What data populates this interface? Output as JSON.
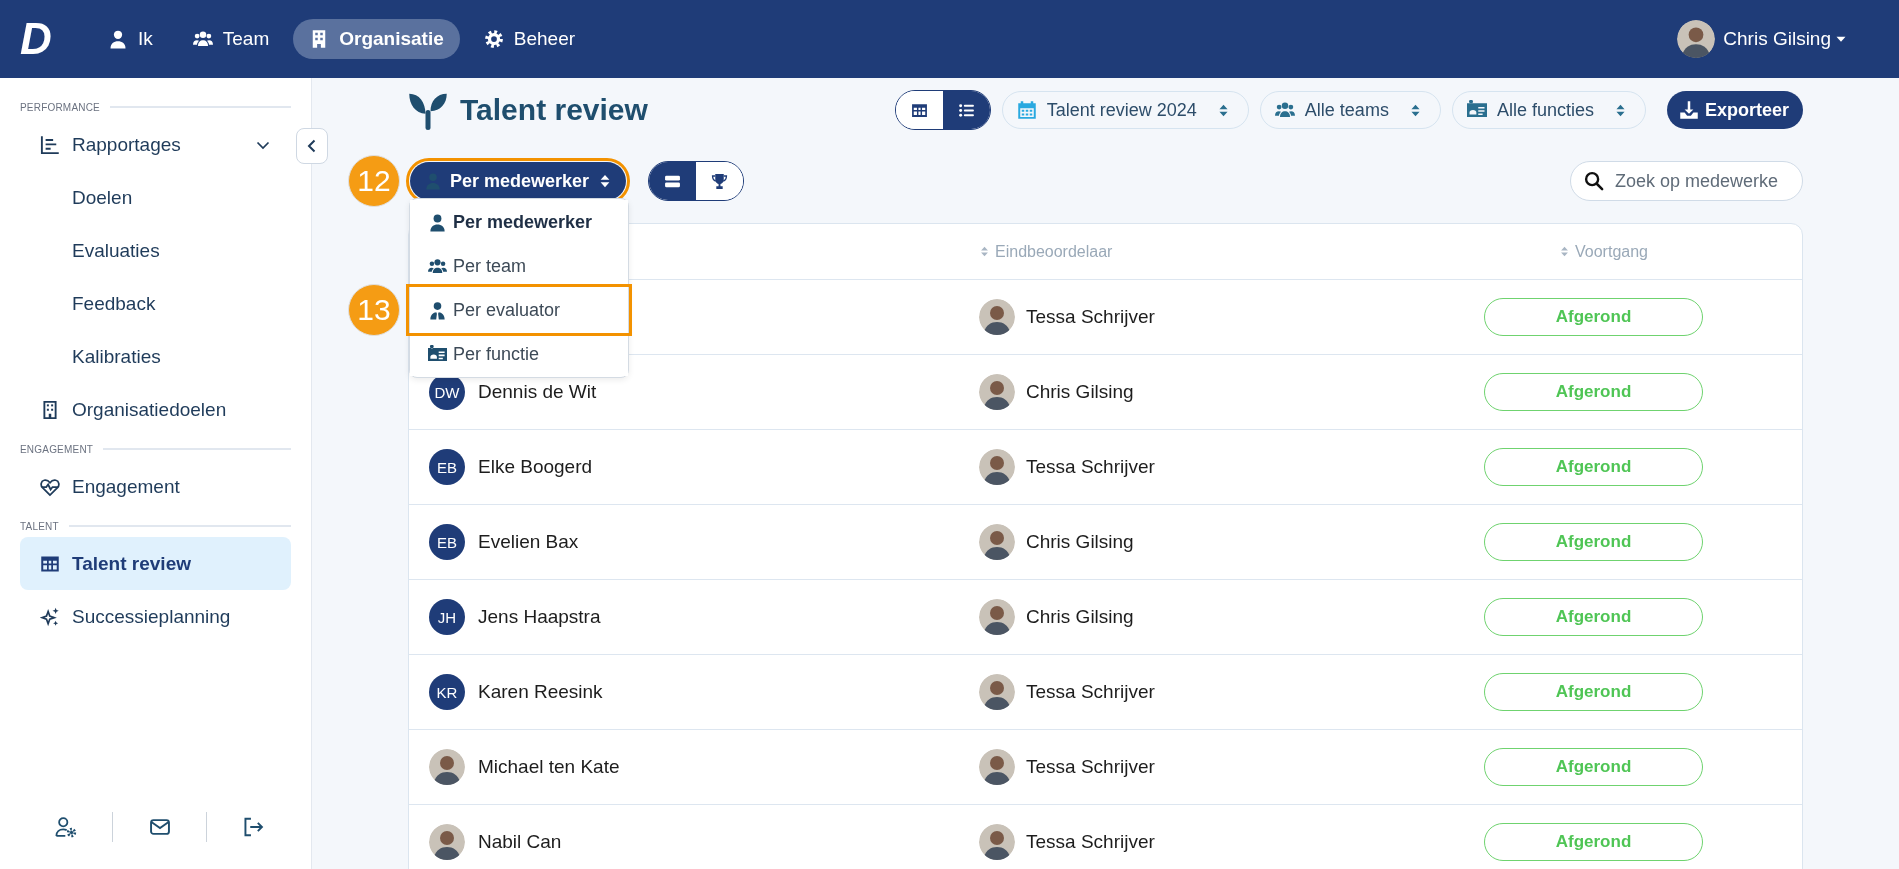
{
  "topbar": {
    "logo": "D",
    "nav": [
      {
        "label": "Ik",
        "kind": "person",
        "selected": false
      },
      {
        "label": "Team",
        "kind": "team",
        "selected": false
      },
      {
        "label": "Organisatie",
        "kind": "building",
        "selected": true
      },
      {
        "label": "Beheer",
        "kind": "gear",
        "selected": false
      }
    ],
    "user": {
      "name": "Chris Gilsing"
    }
  },
  "sidebar": {
    "sections": [
      {
        "title": "PERFORMANCE",
        "items": [
          {
            "label": "Rapportages",
            "kind": "chart",
            "selected": false,
            "expanded": true,
            "children": [
              {
                "label": "Doelen",
                "selected": false
              },
              {
                "label": "Evaluaties",
                "selected": false
              },
              {
                "label": "Feedback",
                "selected": false
              },
              {
                "label": "Kalibraties",
                "selected": false
              }
            ]
          },
          {
            "label": "Organisatiedoelen",
            "kind": "building-outline",
            "selected": false
          }
        ]
      },
      {
        "title": "ENGAGEMENT",
        "items": [
          {
            "label": "Engagement",
            "kind": "heart",
            "selected": false
          }
        ]
      },
      {
        "title": "TALENT",
        "items": [
          {
            "label": "Talent review",
            "kind": "grid",
            "selected": true
          },
          {
            "label": "Successieplanning",
            "kind": "sparkles",
            "selected": false
          }
        ]
      }
    ],
    "footer": [
      {
        "kind": "user-settings"
      },
      {
        "kind": "mail"
      },
      {
        "kind": "logout"
      }
    ]
  },
  "page": {
    "title": "Talent review",
    "view_toggle": [
      {
        "kind": "grid",
        "selected": false
      },
      {
        "kind": "list",
        "selected": true
      }
    ],
    "filters": [
      {
        "label": "Talent review 2024",
        "kind": "calendar"
      },
      {
        "label": "Alle teams",
        "kind": "team"
      },
      {
        "label": "Alle functies",
        "kind": "id-card"
      }
    ],
    "export": "Exporteer",
    "group_by": {
      "label": "Per medewerker",
      "kind": "person",
      "callout": "12",
      "open": true,
      "options": [
        {
          "label": "Per medewerker",
          "kind": "person",
          "selected": true
        },
        {
          "label": "Per team",
          "kind": "team",
          "selected": false
        },
        {
          "label": "Per evaluator",
          "kind": "evaluator",
          "selected": false,
          "callout": "13"
        },
        {
          "label": "Per functie",
          "kind": "id-card",
          "selected": false
        }
      ]
    },
    "mode_toggle": [
      {
        "kind": "rows",
        "selected": true
      },
      {
        "kind": "trophy",
        "selected": false
      }
    ],
    "search": {
      "placeholder": "Zoek op medewerke"
    }
  },
  "table": {
    "columns": [
      "Eindbeoordelaar",
      "Voortgang"
    ],
    "rows": [
      {
        "evaluator": {
          "name": "Tessa Schrijver",
          "avatar": {
            "kind": "photo"
          }
        },
        "status": {
          "label": "Afgerond",
          "kind": "done"
        }
      },
      {
        "employee": {
          "name": "Dennis de Wit",
          "avatar": {
            "kind": "initials",
            "text": "DW"
          }
        },
        "evaluator": {
          "name": "Chris Gilsing",
          "avatar": {
            "kind": "photo"
          }
        },
        "status": {
          "label": "Afgerond",
          "kind": "done"
        }
      },
      {
        "employee": {
          "name": "Elke Boogerd",
          "avatar": {
            "kind": "initials",
            "text": "EB"
          }
        },
        "evaluator": {
          "name": "Tessa Schrijver",
          "avatar": {
            "kind": "photo"
          }
        },
        "status": {
          "label": "Afgerond",
          "kind": "done"
        }
      },
      {
        "employee": {
          "name": "Evelien Bax",
          "avatar": {
            "kind": "initials",
            "text": "EB"
          }
        },
        "evaluator": {
          "name": "Chris Gilsing",
          "avatar": {
            "kind": "photo"
          }
        },
        "status": {
          "label": "Afgerond",
          "kind": "done"
        }
      },
      {
        "employee": {
          "name": "Jens Haapstra",
          "avatar": {
            "kind": "initials",
            "text": "JH"
          }
        },
        "evaluator": {
          "name": "Chris Gilsing",
          "avatar": {
            "kind": "photo"
          }
        },
        "status": {
          "label": "Afgerond",
          "kind": "done"
        }
      },
      {
        "employee": {
          "name": "Karen Reesink",
          "avatar": {
            "kind": "initials",
            "text": "KR"
          }
        },
        "evaluator": {
          "name": "Tessa Schrijver",
          "avatar": {
            "kind": "photo"
          }
        },
        "status": {
          "label": "Afgerond",
          "kind": "done"
        }
      },
      {
        "employee": {
          "name": "Michael ten Kate",
          "avatar": {
            "kind": "photo"
          }
        },
        "evaluator": {
          "name": "Tessa Schrijver",
          "avatar": {
            "kind": "photo"
          }
        },
        "status": {
          "label": "Afgerond",
          "kind": "done"
        }
      },
      {
        "employee": {
          "name": "Nabil Can",
          "avatar": {
            "kind": "photo"
          }
        },
        "evaluator": {
          "name": "Tessa Schrijver",
          "avatar": {
            "kind": "photo"
          }
        },
        "status": {
          "label": "Afgerond",
          "kind": "done"
        }
      }
    ]
  }
}
